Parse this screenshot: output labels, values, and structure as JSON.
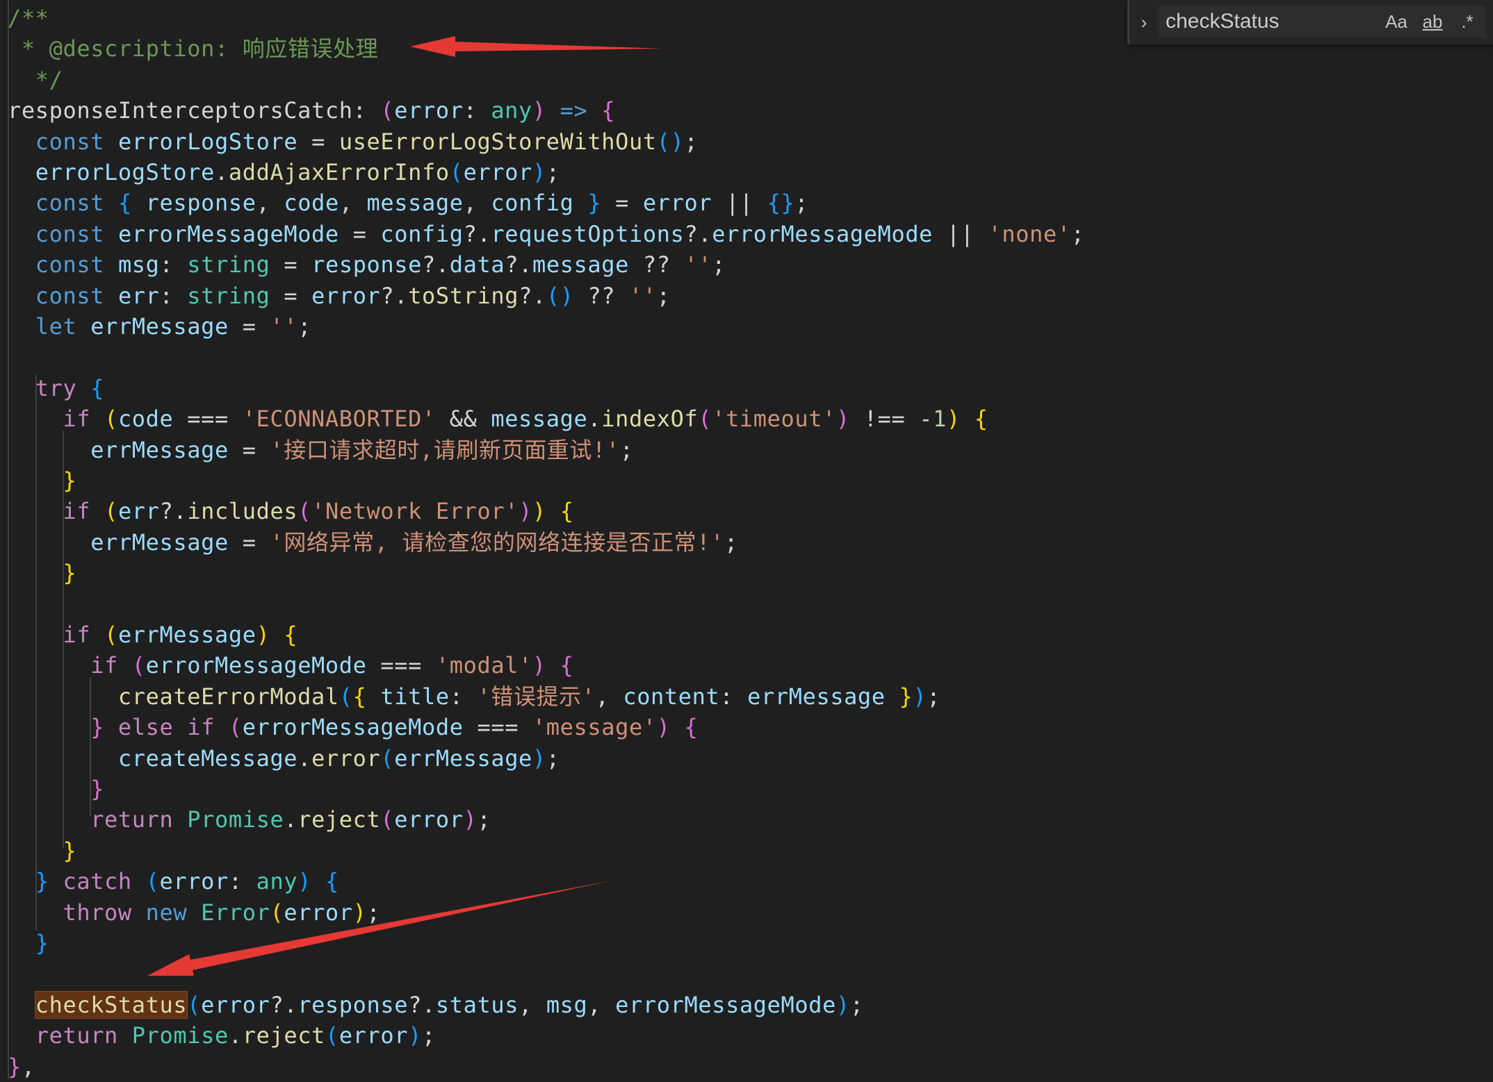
{
  "editor": {
    "lines": [
      [
        [
          "c-com",
          "/**"
        ]
      ],
      [
        [
          "c-com",
          " * @description: 响应错误处理"
        ]
      ],
      [
        [
          "c-com",
          "  */"
        ]
      ],
      [
        [
          "",
          "responseInterceptorsCatch: "
        ],
        [
          "c-br2",
          "("
        ],
        [
          "c-var",
          "error"
        ],
        [
          "",
          ": "
        ],
        [
          "c-type",
          "any"
        ],
        [
          "c-br2",
          ")"
        ],
        [
          "c-kw",
          " => "
        ],
        [
          "c-br2",
          "{"
        ]
      ],
      [
        [
          "c-kw",
          "  const "
        ],
        [
          "c-var",
          "errorLogStore"
        ],
        [
          "",
          " = "
        ],
        [
          "c-fn",
          "useErrorLogStoreWithOut"
        ],
        [
          "c-br3",
          "()"
        ],
        [
          "",
          ";"
        ]
      ],
      [
        [
          "c-var",
          "  errorLogStore"
        ],
        [
          "",
          "."
        ],
        [
          "c-fn",
          "addAjaxErrorInfo"
        ],
        [
          "c-br3",
          "("
        ],
        [
          "c-var",
          "error"
        ],
        [
          "c-br3",
          ")"
        ],
        [
          "",
          ";"
        ]
      ],
      [
        [
          "c-kw",
          "  const "
        ],
        [
          "c-br3",
          "{ "
        ],
        [
          "c-var",
          "response"
        ],
        [
          "",
          ", "
        ],
        [
          "c-var",
          "code"
        ],
        [
          "",
          ", "
        ],
        [
          "c-var",
          "message"
        ],
        [
          "",
          ", "
        ],
        [
          "c-var",
          "config"
        ],
        [
          "c-br3",
          " }"
        ],
        [
          "",
          " = "
        ],
        [
          "c-var",
          "error"
        ],
        [
          "",
          " || "
        ],
        [
          "c-br3",
          "{}"
        ],
        [
          "",
          ";"
        ]
      ],
      [
        [
          "c-kw",
          "  const "
        ],
        [
          "c-var",
          "errorMessageMode"
        ],
        [
          "",
          " = "
        ],
        [
          "c-var",
          "config"
        ],
        [
          "",
          "?."
        ],
        [
          "c-var",
          "requestOptions"
        ],
        [
          "",
          "?."
        ],
        [
          "c-var",
          "errorMessageMode"
        ],
        [
          "",
          " || "
        ],
        [
          "c-str",
          "'none'"
        ],
        [
          "",
          ";"
        ]
      ],
      [
        [
          "c-kw",
          "  const "
        ],
        [
          "c-var",
          "msg"
        ],
        [
          "",
          ": "
        ],
        [
          "c-type",
          "string"
        ],
        [
          "",
          " = "
        ],
        [
          "c-var",
          "response"
        ],
        [
          "",
          "?."
        ],
        [
          "c-var",
          "data"
        ],
        [
          "",
          "?."
        ],
        [
          "c-var",
          "message"
        ],
        [
          "",
          " ?? "
        ],
        [
          "c-str",
          "''"
        ],
        [
          "",
          ";"
        ]
      ],
      [
        [
          "c-kw",
          "  const "
        ],
        [
          "c-var",
          "err"
        ],
        [
          "",
          ": "
        ],
        [
          "c-type",
          "string"
        ],
        [
          "",
          " = "
        ],
        [
          "c-var",
          "error"
        ],
        [
          "",
          "?."
        ],
        [
          "c-fn",
          "toString"
        ],
        [
          "",
          "?."
        ],
        [
          "c-br3",
          "()"
        ],
        [
          "",
          " ?? "
        ],
        [
          "c-str",
          "''"
        ],
        [
          "",
          ";"
        ]
      ],
      [
        [
          "c-kw",
          "  let "
        ],
        [
          "c-var",
          "errMessage"
        ],
        [
          "",
          " = "
        ],
        [
          "c-str",
          "''"
        ],
        [
          "",
          ";"
        ]
      ],
      [],
      [
        [
          "c-ctl",
          "  try "
        ],
        [
          "c-br3",
          "{"
        ]
      ],
      [
        [
          "c-ctl",
          "    if "
        ],
        [
          "c-br",
          "("
        ],
        [
          "c-var",
          "code"
        ],
        [
          "",
          " === "
        ],
        [
          "c-str",
          "'ECONNABORTED'"
        ],
        [
          "",
          " && "
        ],
        [
          "c-var",
          "message"
        ],
        [
          "",
          "."
        ],
        [
          "c-fn",
          "indexOf"
        ],
        [
          "c-br2",
          "("
        ],
        [
          "c-str",
          "'timeout'"
        ],
        [
          "c-br2",
          ")"
        ],
        [
          "",
          " !== "
        ],
        [
          "",
          "-"
        ],
        [
          "c-num",
          "1"
        ],
        [
          "c-br",
          ")"
        ],
        [
          "c-br",
          " {"
        ]
      ],
      [
        [
          "c-var",
          "      errMessage"
        ],
        [
          "",
          " = "
        ],
        [
          "c-str",
          "'接口请求超时,请刷新页面重试!'"
        ],
        [
          "",
          ";"
        ]
      ],
      [
        [
          "c-br",
          "    }"
        ]
      ],
      [
        [
          "c-ctl",
          "    if "
        ],
        [
          "c-br",
          "("
        ],
        [
          "c-var",
          "err"
        ],
        [
          "",
          "?."
        ],
        [
          "c-fn",
          "includes"
        ],
        [
          "c-br2",
          "("
        ],
        [
          "c-str",
          "'Network Error'"
        ],
        [
          "c-br2",
          ")"
        ],
        [
          "c-br",
          ")"
        ],
        [
          "c-br",
          " {"
        ]
      ],
      [
        [
          "c-var",
          "      errMessage"
        ],
        [
          "",
          " = "
        ],
        [
          "c-str",
          "'网络异常, 请检查您的网络连接是否正常!'"
        ],
        [
          "",
          ";"
        ]
      ],
      [
        [
          "c-br",
          "    }"
        ]
      ],
      [],
      [
        [
          "c-ctl",
          "    if "
        ],
        [
          "c-br",
          "("
        ],
        [
          "c-var",
          "errMessage"
        ],
        [
          "c-br",
          ")"
        ],
        [
          "c-br",
          " {"
        ]
      ],
      [
        [
          "c-ctl",
          "      if "
        ],
        [
          "c-br2",
          "("
        ],
        [
          "c-var",
          "errorMessageMode"
        ],
        [
          "",
          " === "
        ],
        [
          "c-str",
          "'modal'"
        ],
        [
          "c-br2",
          ")"
        ],
        [
          "c-br2",
          " {"
        ]
      ],
      [
        [
          "c-fn",
          "        createErrorModal"
        ],
        [
          "c-br3",
          "("
        ],
        [
          "c-br",
          "{ "
        ],
        [
          "c-var",
          "title"
        ],
        [
          "",
          ": "
        ],
        [
          "c-str",
          "'错误提示'"
        ],
        [
          "",
          ", "
        ],
        [
          "c-var",
          "content"
        ],
        [
          "",
          ": "
        ],
        [
          "c-var",
          "errMessage"
        ],
        [
          "c-br",
          " }"
        ],
        [
          "c-br3",
          ")"
        ],
        [
          "",
          ";"
        ]
      ],
      [
        [
          "c-br2",
          "      }"
        ],
        [
          "c-ctl",
          " else if "
        ],
        [
          "c-br2",
          "("
        ],
        [
          "c-var",
          "errorMessageMode"
        ],
        [
          "",
          " === "
        ],
        [
          "c-str",
          "'message'"
        ],
        [
          "c-br2",
          ")"
        ],
        [
          "c-br2",
          " {"
        ]
      ],
      [
        [
          "c-var",
          "        createMessage"
        ],
        [
          "",
          "."
        ],
        [
          "c-fn",
          "error"
        ],
        [
          "c-br3",
          "("
        ],
        [
          "c-var",
          "errMessage"
        ],
        [
          "c-br3",
          ")"
        ],
        [
          "",
          ";"
        ]
      ],
      [
        [
          "c-br2",
          "      }"
        ]
      ],
      [
        [
          "c-ctl",
          "      return "
        ],
        [
          "c-type",
          "Promise"
        ],
        [
          "",
          "."
        ],
        [
          "c-fn",
          "reject"
        ],
        [
          "c-br2",
          "("
        ],
        [
          "c-var",
          "error"
        ],
        [
          "c-br2",
          ")"
        ],
        [
          "",
          ";"
        ]
      ],
      [
        [
          "c-br",
          "    }"
        ]
      ],
      [
        [
          "c-br3",
          "  }"
        ],
        [
          "c-ctl",
          " catch "
        ],
        [
          "c-br3",
          "("
        ],
        [
          "c-var",
          "error"
        ],
        [
          "",
          ": "
        ],
        [
          "c-type",
          "any"
        ],
        [
          "c-br3",
          ")"
        ],
        [
          "c-br3",
          " {"
        ]
      ],
      [
        [
          "c-ctl",
          "    throw "
        ],
        [
          "c-kw",
          "new "
        ],
        [
          "c-type",
          "Error"
        ],
        [
          "c-br",
          "("
        ],
        [
          "c-var",
          "error"
        ],
        [
          "c-br",
          ")"
        ],
        [
          "",
          ";"
        ]
      ],
      [
        [
          "c-br3",
          "  }"
        ]
      ],
      [],
      [
        [
          "",
          "  "
        ],
        [
          "c-fn hl",
          "checkStatus"
        ],
        [
          "c-br3",
          "("
        ],
        [
          "c-var",
          "error"
        ],
        [
          "",
          "?."
        ],
        [
          "c-var",
          "response"
        ],
        [
          "",
          "?."
        ],
        [
          "c-var",
          "status"
        ],
        [
          "",
          ", "
        ],
        [
          "c-var",
          "msg"
        ],
        [
          "",
          ", "
        ],
        [
          "c-var",
          "errorMessageMode"
        ],
        [
          "c-br3",
          ")"
        ],
        [
          "",
          ";"
        ]
      ],
      [
        [
          "c-ctl",
          "  return "
        ],
        [
          "c-type",
          "Promise"
        ],
        [
          "",
          "."
        ],
        [
          "c-fn",
          "reject"
        ],
        [
          "c-br3",
          "("
        ],
        [
          "c-var",
          "error"
        ],
        [
          "c-br3",
          ")"
        ],
        [
          "",
          ";"
        ]
      ],
      [
        [
          "c-br2",
          "}"
        ],
        [
          "",
          ","
        ]
      ]
    ]
  },
  "find_widget": {
    "toggle_icon": "chevron-right-icon",
    "query": "checkStatus",
    "match_case_label": "Aa",
    "whole_word_label": "ab",
    "regex_label": ".*"
  },
  "colors": {
    "background": "#1f1f1f",
    "keyword": "#569cd6",
    "control": "#c586c0",
    "function": "#dcdcaa",
    "variable": "#9cdcfe",
    "string": "#ce9178",
    "type": "#4ec9b0",
    "comment": "#6a9955",
    "highlight": "#613214",
    "annotation_arrow": "#e53935"
  }
}
